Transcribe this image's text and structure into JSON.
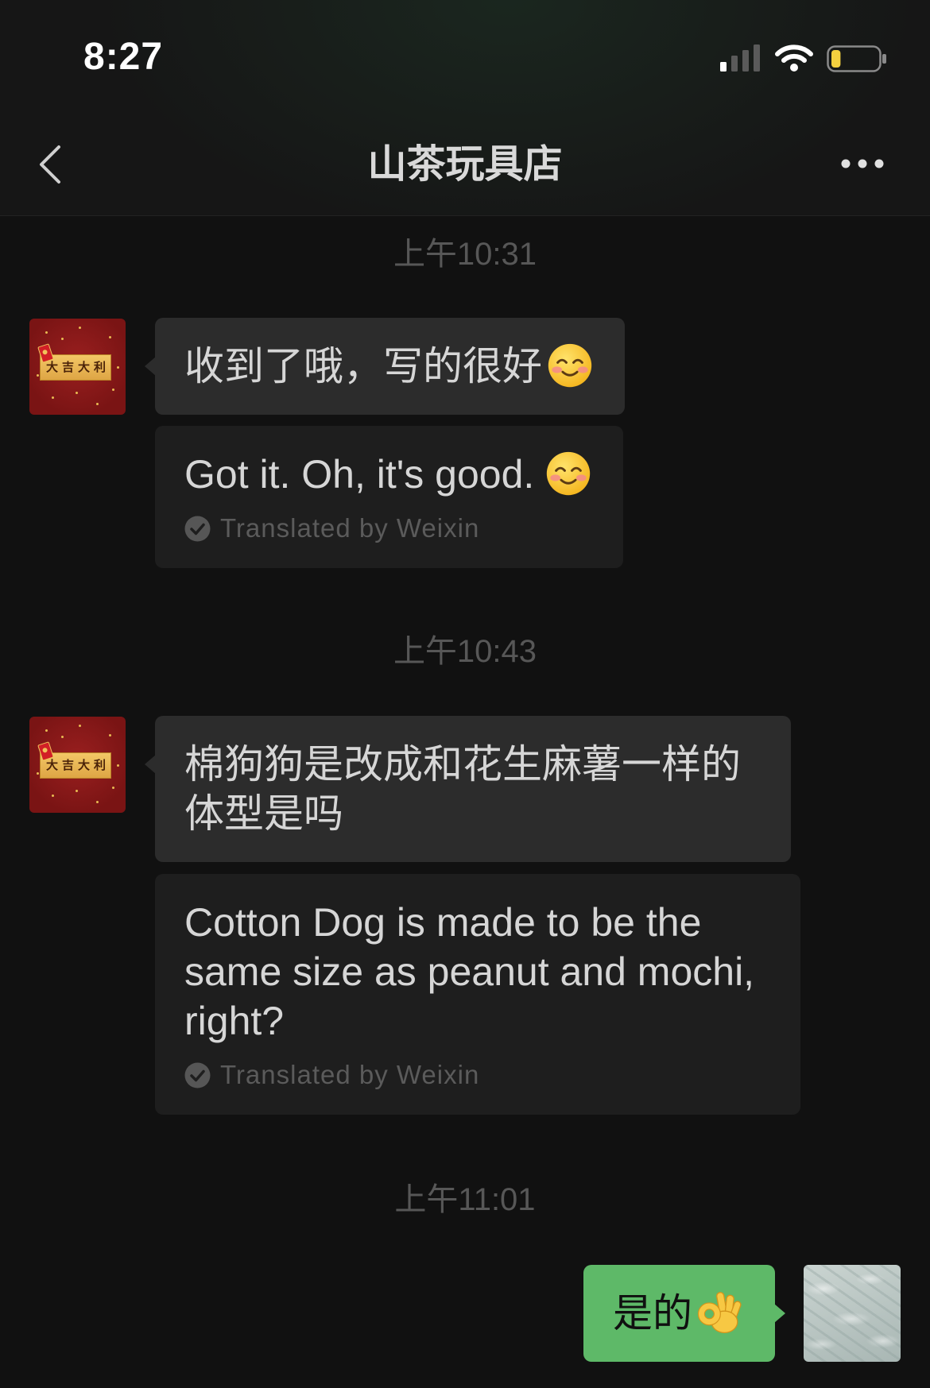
{
  "status_bar": {
    "time": "8:27",
    "signal_bars": {
      "active": 1,
      "total": 4
    },
    "wifi_icon": "wifi-icon",
    "battery_level": 0.2
  },
  "nav": {
    "back_icon": "chevron-left-icon",
    "title": "山茶玩具店",
    "more_icon": "more-dots-icon"
  },
  "chat": {
    "groups": [
      {
        "timestamp": "上午10:31",
        "incoming": {
          "avatar_text": "大吉大利",
          "text": "收到了哦，写的很好",
          "emoji": "smiling-face-emoji"
        },
        "translation": {
          "text": "Got it. Oh, it's good.",
          "emoji": "smiling-face-emoji",
          "label": "Translated by Weixin",
          "icon": "check-circle-icon"
        }
      },
      {
        "timestamp": "上午10:43",
        "incoming": {
          "avatar_text": "大吉大利",
          "text": "棉狗狗是改成和花生麻薯一样的体型是吗"
        },
        "translation": {
          "text": "Cotton Dog is made to be the same size as peanut and mochi, right?",
          "label": "Translated by Weixin",
          "icon": "check-circle-icon"
        }
      },
      {
        "timestamp": "上午11:01",
        "outgoing": {
          "text": "是的",
          "emoji": "ok-hand-emoji"
        }
      }
    ]
  },
  "colors": {
    "background": "#111111",
    "header": "#161616",
    "incoming_bubble": "#2c2c2c",
    "translation_bubble": "#1e1e1e",
    "outgoing_bubble": "#5eb968",
    "message_text": "#d6d6d6",
    "timestamp_text": "#575757",
    "meta_text": "#5b5b5b",
    "battery_fill": "#f4d03f"
  }
}
